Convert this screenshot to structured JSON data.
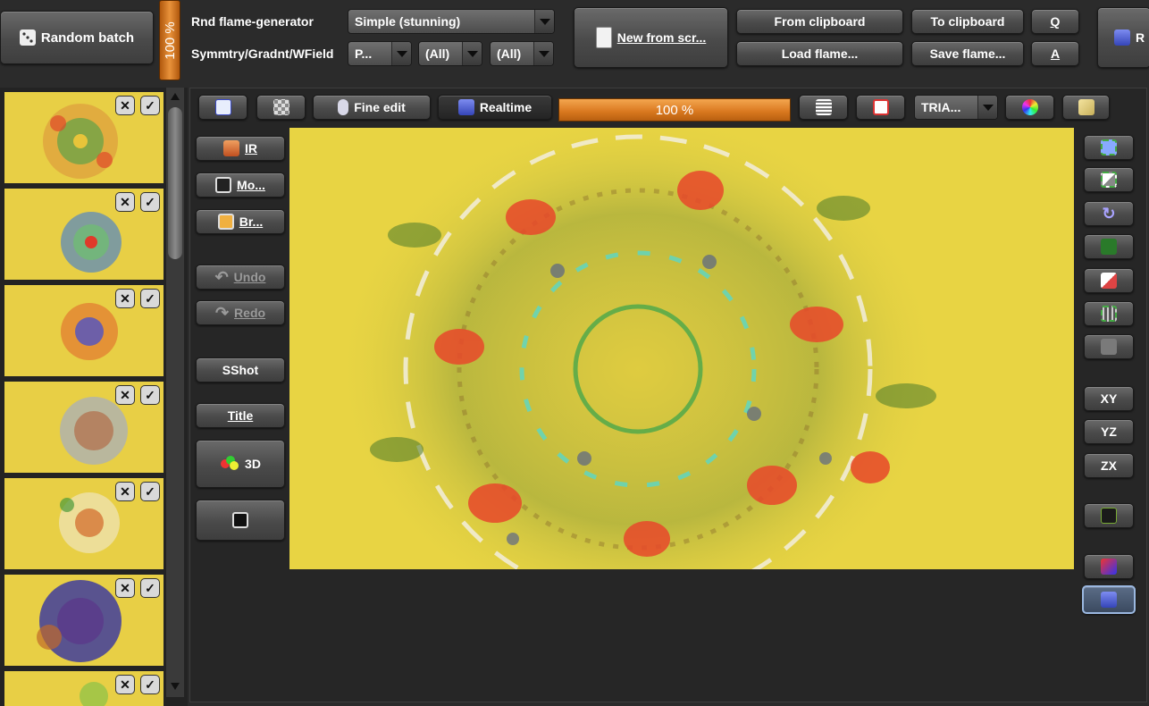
{
  "toolbar": {
    "random_batch": "Random batch",
    "batch_percent": "100 %",
    "rnd_generator_label": "Rnd flame-generator",
    "rnd_generator_value": "Simple (stunning)",
    "symmetry_label": "Symmtry/Gradnt/WField",
    "symmetry_value": "P...",
    "gradient_value": "(All)",
    "wfield_value": "(All)",
    "new_from_scratch": "New from scr...",
    "from_clipboard": "From clipboard",
    "load_flame": "Load flame...",
    "to_clipboard": "To clipboard",
    "save_flame": "Save flame...",
    "q_button": "Q",
    "a_button": "A",
    "render_button": "R"
  },
  "preview_toolbar": {
    "fine_edit": "Fine edit",
    "realtime": "Realtime",
    "progress": "100 %",
    "triangle_mode": "TRIA..."
  },
  "left_tools": {
    "ir": "IR",
    "morph": "Mo...",
    "browse": "Br...",
    "undo": "Undo",
    "redo": "Redo",
    "sshot": "SShot",
    "title": "Title",
    "three_d": "3D"
  },
  "right_tools": {
    "xy": "XY",
    "yz": "YZ",
    "zx": "ZX"
  },
  "thumbnails": [
    {
      "id": 1
    },
    {
      "id": 2
    },
    {
      "id": 3
    },
    {
      "id": 4
    },
    {
      "id": 5
    },
    {
      "id": 6
    },
    {
      "id": 7
    }
  ],
  "colors": {
    "preview_bg": "#e8d443",
    "accent_orange": "#e08a33",
    "panel_bg": "#2b2b2b"
  }
}
